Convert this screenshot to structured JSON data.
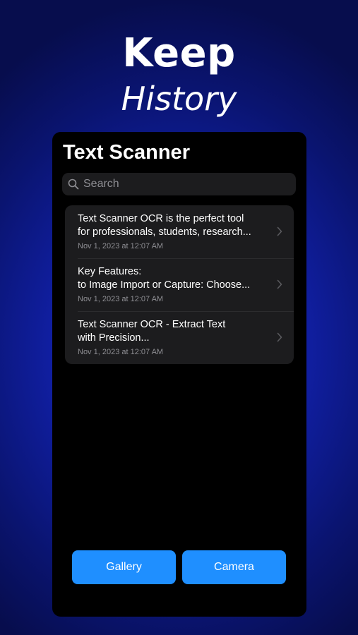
{
  "headline": {
    "line1": "Keep",
    "line2": "History"
  },
  "app": {
    "title": "Text Scanner"
  },
  "search": {
    "placeholder": "Search",
    "icon": "search-icon"
  },
  "notes": [
    {
      "line1": "Text Scanner OCR is the perfect tool",
      "line2": "for professionals, students, research...",
      "date": "Nov 1, 2023 at 12:07 AM"
    },
    {
      "line1": "Key Features:",
      "line2": "to Image Import or Capture: Choose...",
      "date": "Nov 1, 2023 at 12:07 AM"
    },
    {
      "line1": "Text Scanner OCR - Extract Text",
      "line2": "with Precision...",
      "date": "Nov 1, 2023 at 12:07 AM"
    }
  ],
  "buttons": {
    "gallery_label": "Gallery",
    "camera_label": "Camera"
  },
  "colors": {
    "background": "#1120a8",
    "accent": "#1f8fff",
    "card": "#1c1c1e",
    "secondary_text": "#8e8e93"
  }
}
